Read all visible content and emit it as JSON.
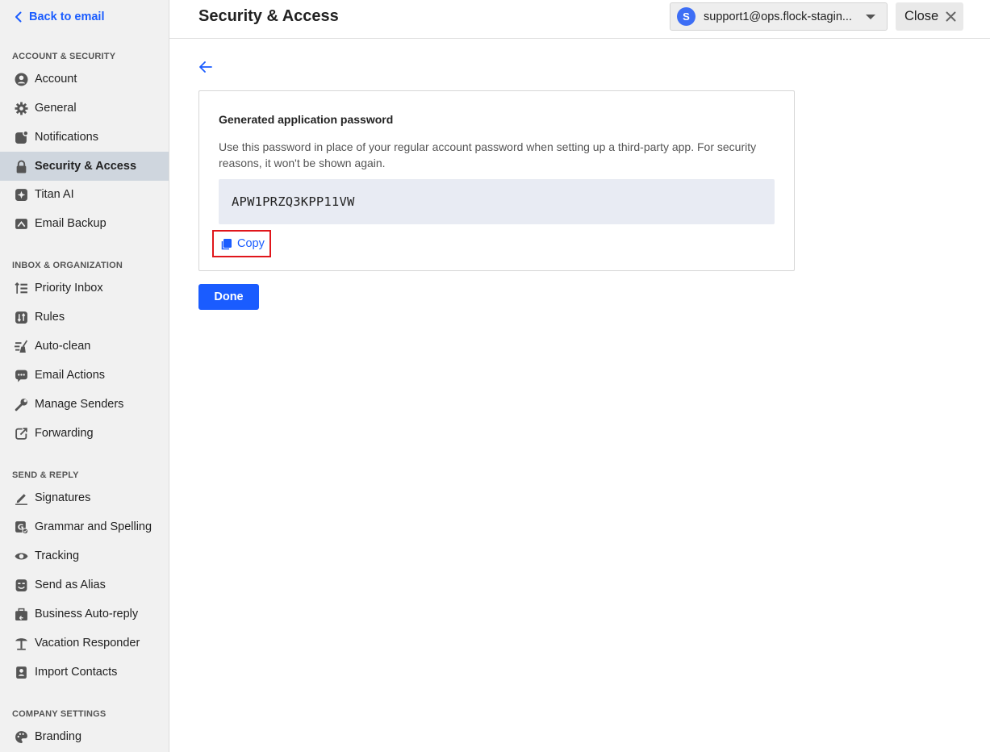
{
  "sidebar": {
    "back_label": "Back to email",
    "sections": [
      {
        "title": "ACCOUNT & SECURITY"
      },
      {
        "title": "INBOX & ORGANIZATION"
      },
      {
        "title": "SEND & REPLY"
      },
      {
        "title": "COMPANY SETTINGS"
      }
    ],
    "items": [
      {
        "label": "Account",
        "icon": "account-icon"
      },
      {
        "label": "General",
        "icon": "gear-icon"
      },
      {
        "label": "Notifications",
        "icon": "notifications-icon"
      },
      {
        "label": "Security & Access",
        "icon": "lock-icon",
        "active": true
      },
      {
        "label": "Titan AI",
        "icon": "sparkle-icon"
      },
      {
        "label": "Email Backup",
        "icon": "backup-icon"
      },
      {
        "label": "Priority Inbox",
        "icon": "priority-icon"
      },
      {
        "label": "Rules",
        "icon": "rules-icon"
      },
      {
        "label": "Auto-clean",
        "icon": "broom-icon"
      },
      {
        "label": "Email Actions",
        "icon": "email-actions-icon"
      },
      {
        "label": "Manage Senders",
        "icon": "wrench-icon"
      },
      {
        "label": "Forwarding",
        "icon": "forward-icon"
      },
      {
        "label": "Signatures",
        "icon": "pen-icon"
      },
      {
        "label": "Grammar and Spelling",
        "icon": "grammar-icon"
      },
      {
        "label": "Tracking",
        "icon": "eye-icon"
      },
      {
        "label": "Send as Alias",
        "icon": "mask-icon"
      },
      {
        "label": "Business Auto-reply",
        "icon": "briefcase-reply-icon"
      },
      {
        "label": "Vacation Responder",
        "icon": "palm-tree-icon"
      },
      {
        "label": "Import Contacts",
        "icon": "contacts-icon"
      },
      {
        "label": "Branding",
        "icon": "palette-icon"
      }
    ]
  },
  "header": {
    "title": "Security & Access",
    "account_initial": "S",
    "account_email": "support1@ops.flock-stagin...",
    "close_label": "Close"
  },
  "card": {
    "title": "Generated application password",
    "description": "Use this password in place of your regular account password when setting up a third-party app. For security reasons, it won't be shown again.",
    "password": "APW1PRZQ3KPP11VW",
    "copy_label": "Copy"
  },
  "done_label": "Done",
  "colors": {
    "accent": "#1a5cff",
    "highlight_border": "#e0161b",
    "active_nav_bg": "#cfd6de",
    "password_bg": "#e8ebf3"
  }
}
